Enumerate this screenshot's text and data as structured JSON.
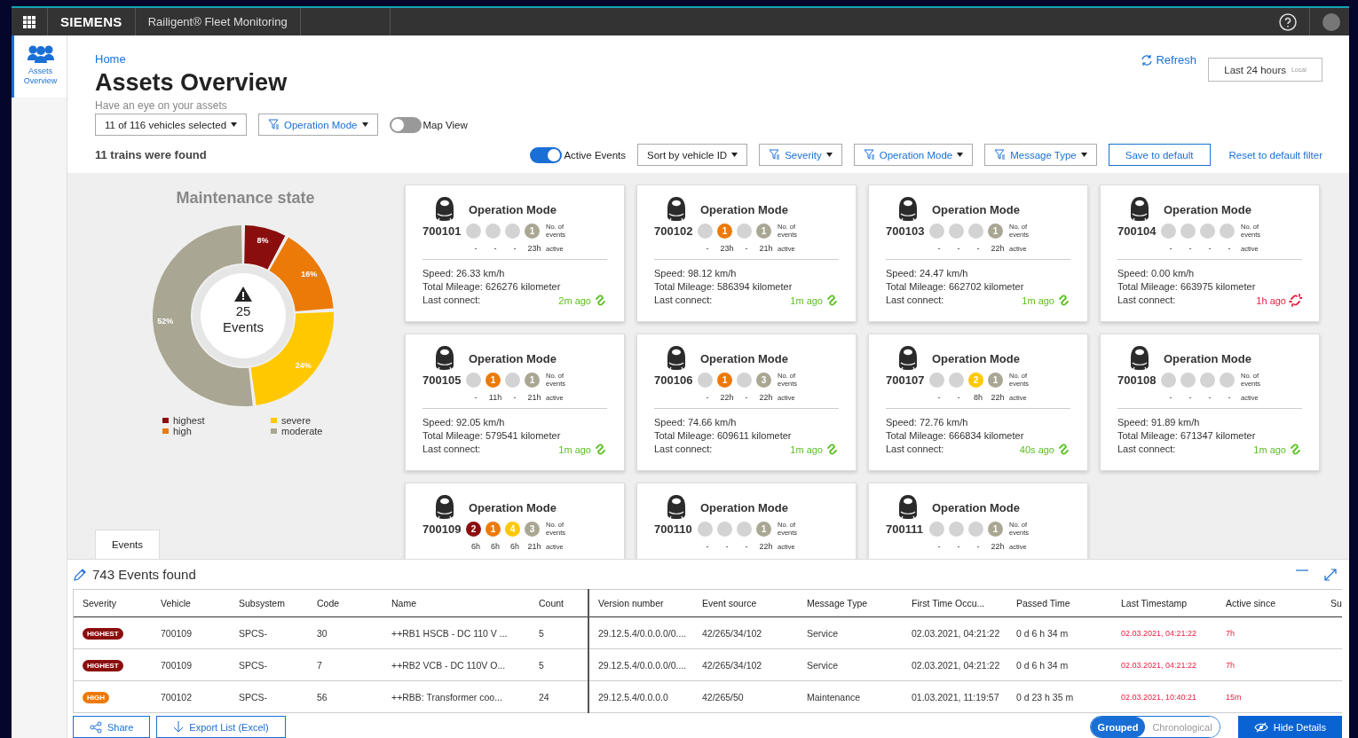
{
  "header": {
    "brand": "SIEMENS",
    "app_title": "Railigent® Fleet Monitoring"
  },
  "sidebar": {
    "items": [
      {
        "label": "Assets Overview",
        "selected": true
      }
    ]
  },
  "breadcrumb": "Home",
  "title": "Assets Overview",
  "subtitle": "Have an eye on your assets",
  "refresh": "Refresh",
  "time_range": {
    "value": "Last 24 hours",
    "zone": "Local"
  },
  "vehicle_select": "11 of 116 vehicles selected",
  "operation_filter": "Operation Mode",
  "map_view": {
    "label": "Map View",
    "on": false
  },
  "result_count": "11 trains were found",
  "active_events": {
    "label": "Active Events",
    "on": true
  },
  "sort": "Sort by vehicle ID",
  "filters": [
    "Severity",
    "Operation Mode",
    "Message Type"
  ],
  "save_default": "Save to default",
  "reset_filter": "Reset to default filter",
  "maintenance": {
    "title": "Maintenance state",
    "center_count": "25",
    "center_label": "Events",
    "legend": [
      {
        "color": "#8b0e0e"
      },
      {
        "color": "#ec7a08"
      },
      {
        "color": "#ffc800"
      },
      {
        "color": "#a9a793"
      }
    ],
    "chart_data": {
      "type": "donut",
      "categories": [
        "highest",
        "high",
        "severe",
        "moderate"
      ],
      "values": [
        8,
        16,
        24,
        52
      ],
      "value_labels": [
        "8%",
        "16%",
        "24%",
        "52%"
      ]
    }
  },
  "tabs": [
    {
      "label": "Events",
      "selected": true
    }
  ],
  "cards": [
    {
      "title": "Operation Mode",
      "id": "700101",
      "events_label": "No. of events",
      "active_label": "active",
      "indicators": [
        {
          "time": "-"
        },
        {
          "time": "-"
        },
        {
          "time": "-"
        },
        {
          "count": "1",
          "time": "23h"
        }
      ],
      "speed": "Speed: 26.33 km/h",
      "mileage": "Total Mileage: 626276 kilometer",
      "connect_label": "Last connect:",
      "last_connect": "2m ago",
      "connected": true
    },
    {
      "title": "Operation Mode",
      "id": "700102",
      "events_label": "No. of events",
      "active_label": "active",
      "indicators": [
        {
          "time": "-"
        },
        {
          "count": "1",
          "time": "23h"
        },
        {
          "time": "-"
        },
        {
          "count": "1",
          "time": "21h"
        }
      ],
      "speed": "Speed: 98.12 km/h",
      "mileage": "Total Mileage: 586394 kilometer",
      "connect_label": "Last connect:",
      "last_connect": "1m ago",
      "connected": true
    },
    {
      "title": "Operation Mode",
      "id": "700103",
      "events_label": "No. of events",
      "active_label": "active",
      "indicators": [
        {
          "time": "-"
        },
        {
          "time": "-"
        },
        {
          "time": "-"
        },
        {
          "count": "1",
          "time": "22h"
        }
      ],
      "speed": "Speed: 24.47 km/h",
      "mileage": "Total Mileage: 662702 kilometer",
      "connect_label": "Last connect:",
      "last_connect": "1m ago",
      "connected": true
    },
    {
      "title": "Operation Mode",
      "id": "700104",
      "events_label": "No. of events",
      "active_label": "active",
      "indicators": [
        {
          "time": "-"
        },
        {
          "time": "-"
        },
        {
          "time": "-"
        },
        {
          "time": "-"
        }
      ],
      "speed": "Speed: 0.00 km/h",
      "mileage": "Total Mileage: 663975 kilometer",
      "connect_label": "Last connect:",
      "last_connect": "1h ago",
      "connected": false
    },
    {
      "title": "Operation Mode",
      "id": "700105",
      "events_label": "No. of events",
      "active_label": "active",
      "indicators": [
        {
          "time": "-"
        },
        {
          "count": "1",
          "time": "11h"
        },
        {
          "time": "-"
        },
        {
          "count": "1",
          "time": "21h"
        }
      ],
      "speed": "Speed: 92.05 km/h",
      "mileage": "Total Mileage: 579541 kilometer",
      "connect_label": "Last connect:",
      "last_connect": "1m ago",
      "connected": true
    },
    {
      "title": "Operation Mode",
      "id": "700106",
      "events_label": "No. of events",
      "active_label": "active",
      "indicators": [
        {
          "time": "-"
        },
        {
          "count": "1",
          "time": "22h"
        },
        {
          "time": "-"
        },
        {
          "count": "3",
          "time": "22h"
        }
      ],
      "speed": "Speed: 74.66 km/h",
      "mileage": "Total Mileage: 609611 kilometer",
      "connect_label": "Last connect:",
      "last_connect": "1m ago",
      "connected": true
    },
    {
      "title": "Operation Mode",
      "id": "700107",
      "events_label": "No. of events",
      "active_label": "active",
      "indicators": [
        {
          "time": "-"
        },
        {
          "time": "-"
        },
        {
          "count": "2",
          "time": "8h"
        },
        {
          "count": "1",
          "time": "22h"
        }
      ],
      "speed": "Speed: 72.76 km/h",
      "mileage": "Total Mileage: 666834 kilometer",
      "connect_label": "Last connect:",
      "last_connect": "40s ago",
      "connected": true
    },
    {
      "title": "Operation Mode",
      "id": "700108",
      "events_label": "No. of events",
      "active_label": "active",
      "indicators": [
        {
          "time": "-"
        },
        {
          "time": "-"
        },
        {
          "time": "-"
        },
        {
          "time": "-"
        }
      ],
      "speed": "Speed: 91.89 km/h",
      "mileage": "Total Mileage: 671347 kilometer",
      "connect_label": "Last connect:",
      "last_connect": "1m ago",
      "connected": true
    },
    {
      "title": "Operation Mode",
      "id": "700109",
      "events_label": "No. of events",
      "active_label": "active",
      "indicators": [
        {
          "count": "2",
          "time": "6h"
        },
        {
          "count": "1",
          "time": "6h"
        },
        {
          "count": "4",
          "time": "6h"
        },
        {
          "count": "3",
          "time": "21h"
        }
      ]
    },
    {
      "title": "Operation Mode",
      "id": "700110",
      "events_label": "No. of events",
      "active_label": "active",
      "indicators": [
        {
          "time": "-"
        },
        {
          "time": "-"
        },
        {
          "time": "-"
        },
        {
          "count": "1",
          "time": "22h"
        }
      ]
    },
    {
      "title": "Operation Mode",
      "id": "700111",
      "events_label": "No. of events",
      "active_label": "active",
      "indicators": [
        {
          "time": "-"
        },
        {
          "time": "-"
        },
        {
          "time": "-"
        },
        {
          "count": "1",
          "time": "22h"
        }
      ]
    }
  ],
  "events": {
    "title": "743 Events found",
    "columns": [
      "Severity",
      "Vehicle",
      "Subsystem",
      "Code",
      "Name",
      "Count",
      "Version number",
      "Event source",
      "Message Type",
      "First Time Occu...",
      "Passed Time",
      "Last Timestamp",
      "Active since",
      "Su"
    ],
    "rows": [
      {
        "kind": "highest",
        "cells": [
          "HIGHEST",
          "700109",
          "SPCS-",
          "30",
          "++RB1 HSCB - DC 110 V ...",
          "5",
          "29.12.5.4/0.0.0.0/0....",
          "42/265/34/102",
          "Service",
          "02.03.2021, 04:21:22",
          "0 d 6 h 34 m",
          "02.03.2021, 04:21:22",
          "7h"
        ]
      },
      {
        "kind": "highest",
        "cells": [
          "HIGHEST",
          "700109",
          "SPCS-",
          "7",
          "++RB2 VCB - DC 110V O...",
          "5",
          "29.12.5.4/0.0.0.0/0....",
          "42/265/34/102",
          "Service",
          "02.03.2021, 04:21:22",
          "0 d 6 h 34 m",
          "02.03.2021, 04:21:22",
          "7h"
        ]
      },
      {
        "kind": "high",
        "cells": [
          "HIGH",
          "700102",
          "SPCS-",
          "56",
          "++RBB: Transformer coo...",
          "24",
          "29.12.5.4/0.0.0.0",
          "42/265/50",
          "Maintenance",
          "01.03.2021, 11:19:57",
          "0 d 23 h 35 m",
          "02.03.2021, 10:40:21",
          "15m"
        ]
      }
    ]
  },
  "footer": {
    "share": "Share",
    "export": "Export List (Excel)",
    "view_modes": [
      {
        "label": "Grouped",
        "selected": true
      },
      {
        "label": "Chronological",
        "selected": false
      }
    ],
    "hide_details": "Hide Details"
  }
}
